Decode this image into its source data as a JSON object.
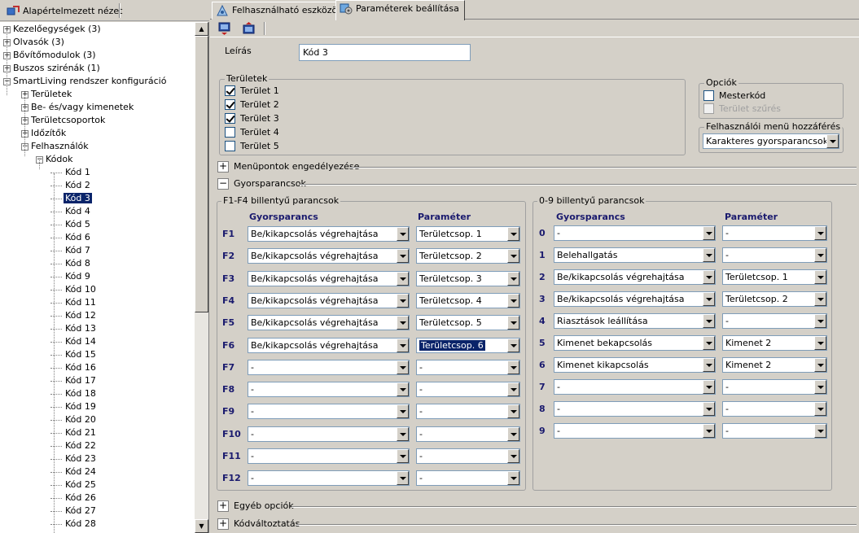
{
  "left_toolbar": {
    "default_view_label": "Alapértelmezett nézet"
  },
  "tree": {
    "items": [
      {
        "label": "Kezelőegységek (3)",
        "level": 0,
        "expander": "+"
      },
      {
        "label": "Olvasók (3)",
        "level": 0,
        "expander": "+"
      },
      {
        "label": "Bővítőmodulok (3)",
        "level": 0,
        "expander": "+"
      },
      {
        "label": "Buszos szirénák (1)",
        "level": 0,
        "expander": "+"
      },
      {
        "label": "SmartLiving rendszer konfiguráció",
        "level": 0,
        "expander": "-"
      },
      {
        "label": "Területek",
        "level": 1,
        "expander": "+"
      },
      {
        "label": "Be- és/vagy kimenetek",
        "level": 1,
        "expander": "+"
      },
      {
        "label": "Területcsoportok",
        "level": 1,
        "expander": "+"
      },
      {
        "label": "Időzítők",
        "level": 1,
        "expander": "+"
      },
      {
        "label": "Felhasználók",
        "level": 1,
        "expander": "-"
      },
      {
        "label": "Kódok",
        "level": 2,
        "expander": "-"
      },
      {
        "label": "Kód 1",
        "level": 3
      },
      {
        "label": "Kód 2",
        "level": 3
      },
      {
        "label": "Kód 3",
        "level": 3,
        "selected": true
      },
      {
        "label": "Kód 4",
        "level": 3
      },
      {
        "label": "Kód 5",
        "level": 3
      },
      {
        "label": "Kód 6",
        "level": 3
      },
      {
        "label": "Kód 7",
        "level": 3
      },
      {
        "label": "Kód 8",
        "level": 3
      },
      {
        "label": "Kód 9",
        "level": 3
      },
      {
        "label": "Kód 10",
        "level": 3
      },
      {
        "label": "Kód 11",
        "level": 3
      },
      {
        "label": "Kód 12",
        "level": 3
      },
      {
        "label": "Kód 13",
        "level": 3
      },
      {
        "label": "Kód 14",
        "level": 3
      },
      {
        "label": "Kód 15",
        "level": 3
      },
      {
        "label": "Kód 16",
        "level": 3
      },
      {
        "label": "Kód 17",
        "level": 3
      },
      {
        "label": "Kód 18",
        "level": 3
      },
      {
        "label": "Kód 19",
        "level": 3
      },
      {
        "label": "Kód 20",
        "level": 3
      },
      {
        "label": "Kód 21",
        "level": 3
      },
      {
        "label": "Kód 22",
        "level": 3
      },
      {
        "label": "Kód 23",
        "level": 3
      },
      {
        "label": "Kód 24",
        "level": 3
      },
      {
        "label": "Kód 25",
        "level": 3
      },
      {
        "label": "Kód 26",
        "level": 3
      },
      {
        "label": "Kód 27",
        "level": 3
      },
      {
        "label": "Kód 28",
        "level": 3
      }
    ]
  },
  "tabs": [
    {
      "label": "Felhasználható eszközök",
      "active": false
    },
    {
      "label": "Paraméterek beállítása",
      "active": true
    }
  ],
  "form": {
    "description_label": "Leírás",
    "description_value": "Kód 3",
    "areas": {
      "title": "Területek",
      "items": [
        {
          "label": "Terület 1",
          "checked": true
        },
        {
          "label": "Terület 2",
          "checked": true
        },
        {
          "label": "Terület 3",
          "checked": true
        },
        {
          "label": "Terület 4",
          "checked": false
        },
        {
          "label": "Terület 5",
          "checked": false
        }
      ]
    },
    "options": {
      "title": "Opciók",
      "master_code": "Mesterkód",
      "area_filter": "Terület szűrés"
    },
    "user_menu": {
      "title": "Felhasználói menü hozzáférés",
      "value": "Karakteres gyorsparancsok"
    },
    "sections": {
      "menu_enable": "Menüpontok engedélyezése",
      "shortcuts": "Gyorsparancsok",
      "other_options": "Egyéb opciók",
      "code_change": "Kódváltoztatás"
    },
    "f_group": {
      "title": "F1-F4 billentyű parancsok",
      "col_shortcut": "Gyorsparancs",
      "col_param": "Paraméter",
      "rows": [
        {
          "key": "F1",
          "shortcut": "Be/kikapcsolás végrehajtása",
          "param": "Területcsop. 1"
        },
        {
          "key": "F2",
          "shortcut": "Be/kikapcsolás végrehajtása",
          "param": "Területcsop. 2"
        },
        {
          "key": "F3",
          "shortcut": "Be/kikapcsolás végrehajtása",
          "param": "Területcsop. 3"
        },
        {
          "key": "F4",
          "shortcut": "Be/kikapcsolás végrehajtása",
          "param": "Területcsop. 4"
        },
        {
          "key": "F5",
          "shortcut": "Be/kikapcsolás végrehajtása",
          "param": "Területcsop. 5"
        },
        {
          "key": "F6",
          "shortcut": "Be/kikapcsolás végrehajtása",
          "param": "Területcsop. 6",
          "focused": true
        },
        {
          "key": "F7",
          "shortcut": "-",
          "param": "-"
        },
        {
          "key": "F8",
          "shortcut": "-",
          "param": "-"
        },
        {
          "key": "F9",
          "shortcut": "-",
          "param": "-"
        },
        {
          "key": "F10",
          "shortcut": "-",
          "param": "-"
        },
        {
          "key": "F11",
          "shortcut": "-",
          "param": "-"
        },
        {
          "key": "F12",
          "shortcut": "-",
          "param": "-"
        }
      ]
    },
    "n_group": {
      "title": "0-9 billentyű parancsok",
      "col_shortcut": "Gyorsparancs",
      "col_param": "Paraméter",
      "rows": [
        {
          "key": "0",
          "shortcut": "-",
          "param": "-"
        },
        {
          "key": "1",
          "shortcut": "Belehallgatás",
          "param": "-"
        },
        {
          "key": "2",
          "shortcut": "Be/kikapcsolás végrehajtása",
          "param": "Területcsop. 1"
        },
        {
          "key": "3",
          "shortcut": "Be/kikapcsolás végrehajtása",
          "param": "Területcsop. 2"
        },
        {
          "key": "4",
          "shortcut": "Riasztások leállítása",
          "param": "-"
        },
        {
          "key": "5",
          "shortcut": "Kimenet bekapcsolás",
          "param": "Kimenet 2"
        },
        {
          "key": "6",
          "shortcut": "Kimenet kikapcsolás",
          "param": "Kimenet 2"
        },
        {
          "key": "7",
          "shortcut": "-",
          "param": "-"
        },
        {
          "key": "8",
          "shortcut": "-",
          "param": "-"
        },
        {
          "key": "9",
          "shortcut": "-",
          "param": "-"
        }
      ]
    }
  }
}
